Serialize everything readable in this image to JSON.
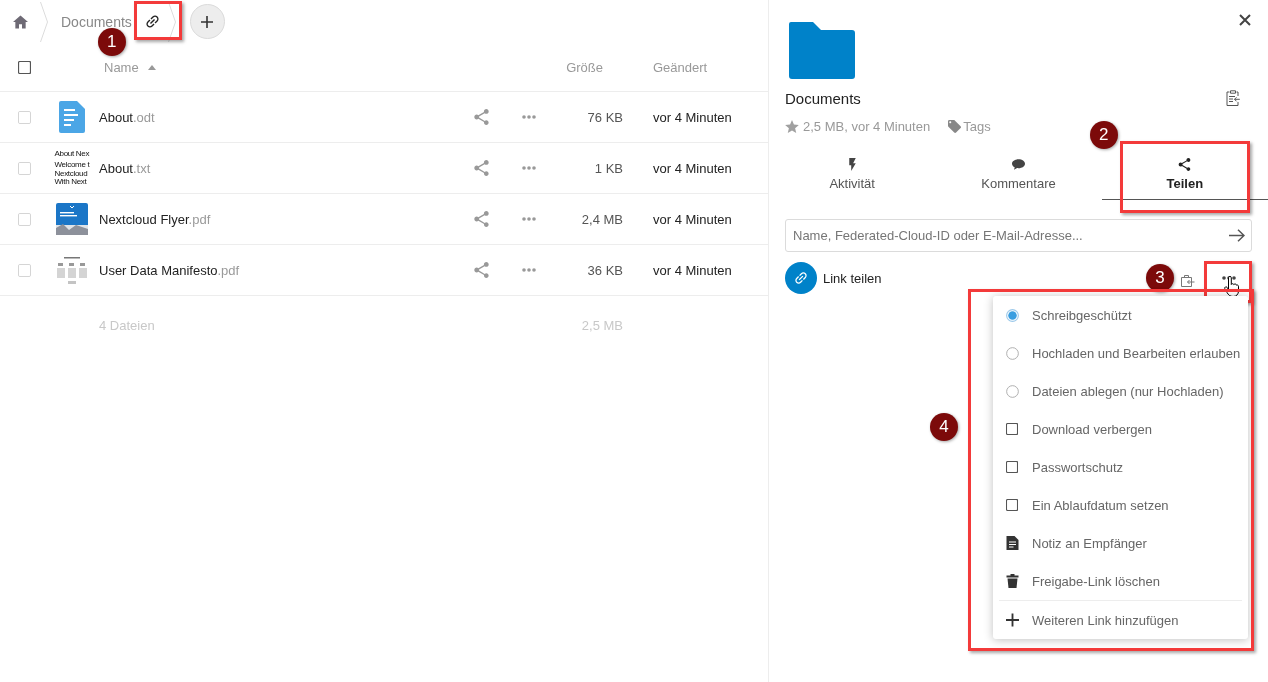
{
  "breadcrumb": {
    "folder": "Documents",
    "callout": "1"
  },
  "file_list": {
    "all_checked": false,
    "columns": [
      "Name",
      "Größe",
      "Geändert"
    ],
    "files": [
      {
        "name": "About",
        "extension": ".odt",
        "thumbnail": {
          "kind": "document"
        },
        "size": "76 KB",
        "modified": "vor 4 Minuten",
        "checked": false
      },
      {
        "name": "About",
        "extension": ".txt",
        "thumbnail": {
          "kind": "text",
          "lines": [
            "About Nex",
            "Welcome t",
            "Nextcloud",
            "With Next"
          ]
        },
        "size": "1 KB",
        "modified": "vor 4 Minuten",
        "checked": false
      },
      {
        "name": "Nextcloud Flyer",
        "extension": ".pdf",
        "thumbnail": {
          "kind": "flyer"
        },
        "size": "2,4 MB",
        "modified": "vor 4 Minuten",
        "checked": false
      },
      {
        "name": "User Data Manifesto",
        "extension": ".pdf",
        "thumbnail": {
          "kind": "manifesto"
        },
        "size": "36 KB",
        "modified": "vor 4 Minuten",
        "checked": false
      }
    ],
    "summary": {
      "count": "4 Dateien",
      "size": "2,5 MB"
    }
  },
  "sidebar": {
    "title": "Documents",
    "favorite": false,
    "meta": "2,5 MB, vor 4 Minuten",
    "tags": "Tags",
    "tabs": [
      {
        "label": "Aktivität",
        "kind": "activity",
        "selected": false
      },
      {
        "label": "Kommentare",
        "kind": "comment",
        "selected": false
      },
      {
        "label": "Teilen",
        "kind": "share",
        "selected": true,
        "callout": "2"
      }
    ],
    "share_input": {
      "placeholder": "Name, Federated-Cloud-ID oder E-Mail-Adresse..."
    },
    "link_share": {
      "label": "Link teilen",
      "callout": "3",
      "menu": {
        "callout": "4",
        "items": [
          {
            "kind": "radio",
            "label": "Schreibgeschützt",
            "selected": true
          },
          {
            "kind": "radio",
            "label": "Hochladen und Bearbeiten erlauben",
            "selected": false
          },
          {
            "kind": "radio",
            "label": "Dateien ablegen (nur Hochladen)",
            "selected": false
          },
          {
            "kind": "checkbox",
            "label": "Download verbergen",
            "checked": false
          },
          {
            "kind": "checkbox",
            "label": "Passwortschutz",
            "checked": false
          },
          {
            "kind": "checkbox",
            "label": "Ein Ablaufdatum setzen",
            "checked": false
          },
          {
            "kind": "note",
            "label": "Notiz an Empfänger"
          },
          {
            "kind": "delete",
            "label": "Freigabe-Link löschen"
          },
          {
            "kind": "add",
            "label": "Weiteren Link hinzufügen"
          }
        ]
      }
    }
  }
}
